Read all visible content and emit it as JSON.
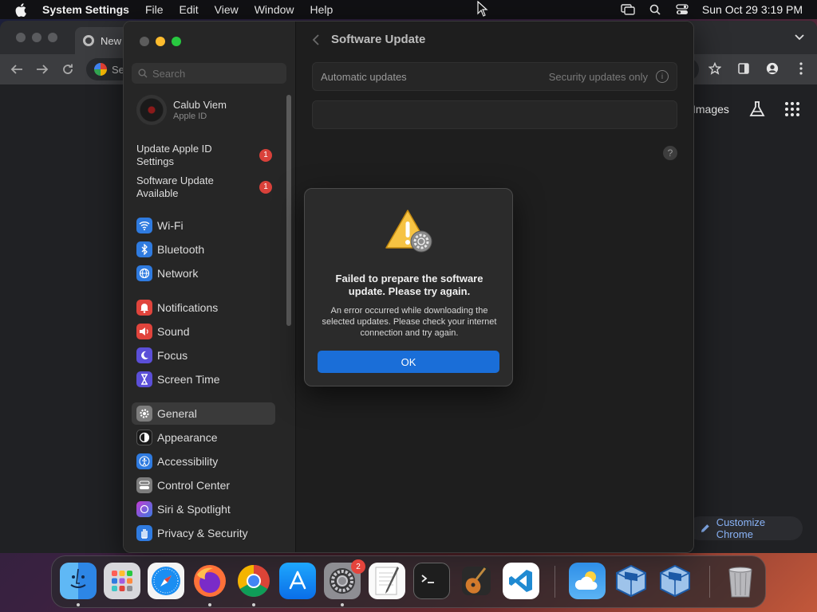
{
  "menubar": {
    "app_name": "System Settings",
    "items": [
      "File",
      "Edit",
      "View",
      "Window",
      "Help"
    ],
    "clock": "Sun Oct 29  3:19 PM"
  },
  "chrome": {
    "tab_label": "New",
    "omnibox_text": "Se",
    "images_link": "Images",
    "customize_label": "Customize Chrome"
  },
  "settings": {
    "search_placeholder": "Search",
    "account": {
      "name": "Calub Viem",
      "subtitle": "Apple ID"
    },
    "notices": [
      {
        "label": "Update Apple ID Settings",
        "badge": "1"
      },
      {
        "label": "Software Update Available",
        "badge": "1"
      }
    ],
    "sidebar": {
      "network": [
        "Wi-Fi",
        "Bluetooth",
        "Network"
      ],
      "focus": [
        "Notifications",
        "Sound",
        "Focus",
        "Screen Time"
      ],
      "system": [
        "General",
        "Appearance",
        "Accessibility",
        "Control Center",
        "Siri & Spotlight",
        "Privacy & Security"
      ]
    },
    "page_title": "Software Update",
    "automatic_updates_label": "Automatic updates",
    "automatic_updates_value": "Security updates only",
    "help_glyph": "?"
  },
  "alert": {
    "title": "Failed to prepare the software update. Please try again.",
    "message": "An error occurred while downloading the selected updates. Please check your internet connection and try again.",
    "ok_label": "OK"
  },
  "dock": {
    "apps": [
      "Finder",
      "Launchpad",
      "Safari",
      "Firefox",
      "Google Chrome",
      "App Store",
      "System Settings",
      "TextEdit",
      "Terminal",
      "GarageBand",
      "Visual Studio Code",
      "Weather",
      "VirtualBox",
      "VirtualBox VM",
      "Trash"
    ],
    "settings_badge": "2"
  },
  "colors": {
    "accent": "#1a6ed8",
    "badge": "#d9413a",
    "traffic_min": "#febc2e",
    "traffic_max": "#28c840"
  }
}
